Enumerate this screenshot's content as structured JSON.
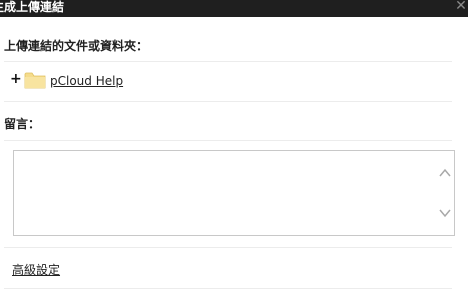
{
  "dialog": {
    "title": "生成上傳連結",
    "close_icon": "close-icon"
  },
  "upload_target": {
    "label": "上傳連結的文件或資料夾：",
    "expand_icon": "plus-icon",
    "folder_icon": "folder-icon",
    "folder_name": "pCloud Help",
    "folder_color": "#f5dc8c"
  },
  "message": {
    "label": "留言：",
    "value": ""
  },
  "advanced": {
    "label": "高級設定"
  }
}
